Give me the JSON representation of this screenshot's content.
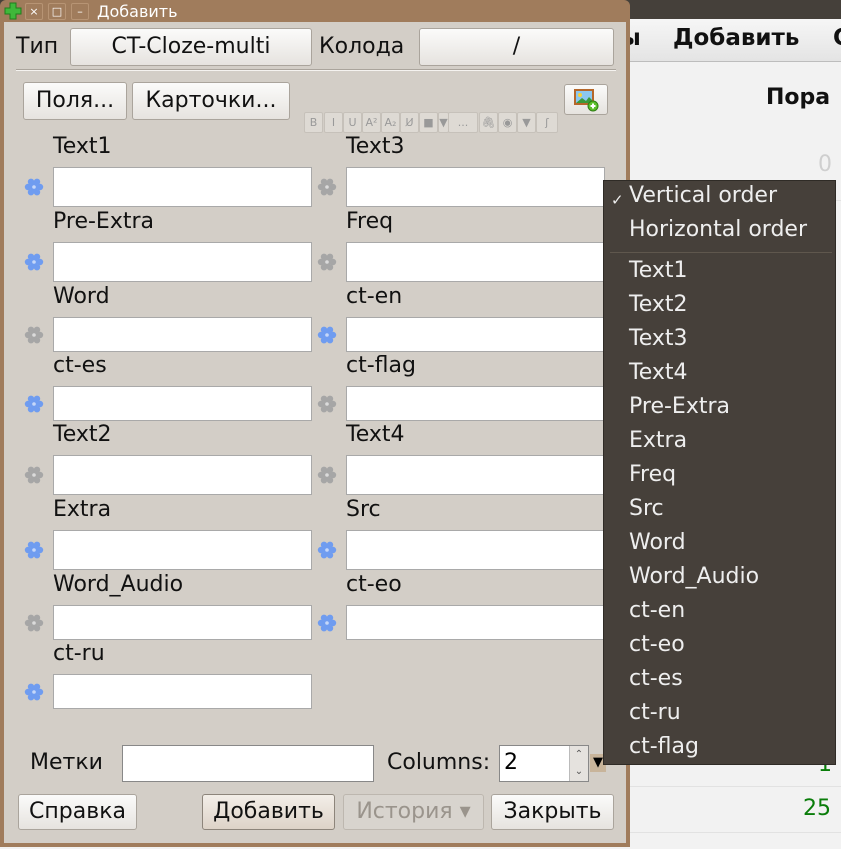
{
  "background_window": {
    "toolbar": {
      "partial_left": "ы",
      "add": "Добавить",
      "partial_right": "С"
    },
    "column_header": "Пора",
    "values": [
      {
        "text": "0",
        "color": "#cfcfcf"
      },
      {
        "text": "1",
        "color": "#0a7d0a"
      },
      {
        "text": "25",
        "color": "#0a7d0a"
      }
    ]
  },
  "dialog": {
    "title": "Добавить",
    "titlebar_buttons": {
      "close": "×",
      "maximize": "□",
      "minimize": "–"
    },
    "type_label": "Тип",
    "type_value": "CT-Cloze-multi",
    "deck_label": "Колода",
    "deck_value": "/",
    "fields_button": "Поля...",
    "cards_button": "Карточки...",
    "format_tools": [
      {
        "icon": "bold-icon",
        "glyph": "B"
      },
      {
        "icon": "italic-icon",
        "glyph": "I"
      },
      {
        "icon": "underline-icon",
        "glyph": "U"
      },
      {
        "icon": "superscript-icon",
        "glyph": "A²"
      },
      {
        "icon": "subscript-icon",
        "glyph": "A₂"
      },
      {
        "icon": "clear-format-icon",
        "glyph": "U̸"
      },
      {
        "icon": "text-color-icon",
        "glyph": "■"
      },
      {
        "icon": "color-dropdown-icon",
        "glyph": "▼"
      },
      {
        "icon": "cloze-icon",
        "glyph": "..."
      },
      {
        "icon": "attach-icon",
        "glyph": "🖇"
      },
      {
        "icon": "record-icon",
        "glyph": "◉"
      },
      {
        "icon": "more-dropdown-icon",
        "glyph": "▼"
      },
      {
        "icon": "latex-icon",
        "glyph": "ʃ"
      }
    ],
    "fields": [
      {
        "label": "Text1",
        "value": "",
        "sticky": true
      },
      {
        "label": "Text3",
        "value": "",
        "sticky": false
      },
      {
        "label": "Pre-Extra",
        "value": "",
        "sticky": true
      },
      {
        "label": "Freq",
        "value": "",
        "sticky": false
      },
      {
        "label": "Word",
        "value": "",
        "sticky": false
      },
      {
        "label": "ct-en",
        "value": "",
        "sticky": true
      },
      {
        "label": "ct-es",
        "value": "",
        "sticky": true
      },
      {
        "label": "ct-flag",
        "value": "",
        "sticky": false
      },
      {
        "label": "Text2",
        "value": "",
        "sticky": false
      },
      {
        "label": "Text4",
        "value": "",
        "sticky": false
      },
      {
        "label": "Extra",
        "value": "",
        "sticky": true
      },
      {
        "label": "Src",
        "value": "",
        "sticky": true
      },
      {
        "label": "Word_Audio",
        "value": "",
        "sticky": false
      },
      {
        "label": "ct-eo",
        "value": "",
        "sticky": true
      },
      {
        "label": "ct-ru",
        "value": "",
        "sticky": true
      }
    ],
    "tags_label": "Метки",
    "tags_value": "",
    "columns_label": "Columns:",
    "columns_value": "2",
    "help_button": "Справка",
    "add_button": "Добавить",
    "history_button": "История ▾",
    "close_button": "Закрыть"
  },
  "context_menu": {
    "order_items": [
      {
        "label": "Vertical order",
        "checked": true
      },
      {
        "label": "Horizontal order",
        "checked": false
      }
    ],
    "check_glyph": "✓",
    "field_items": [
      "Text1",
      "Text2",
      "Text3",
      "Text4",
      "Pre-Extra",
      "Extra",
      "Freq",
      "Src",
      "Word",
      "Word_Audio",
      "ct-en",
      "ct-eo",
      "ct-es",
      "ct-ru",
      "ct-flag"
    ]
  },
  "colors": {
    "sticky_on": "#6f9cf0",
    "sticky_off": "#a6a6a6",
    "titlebar": "#a07c5c",
    "menu_bg": "#46403a"
  }
}
